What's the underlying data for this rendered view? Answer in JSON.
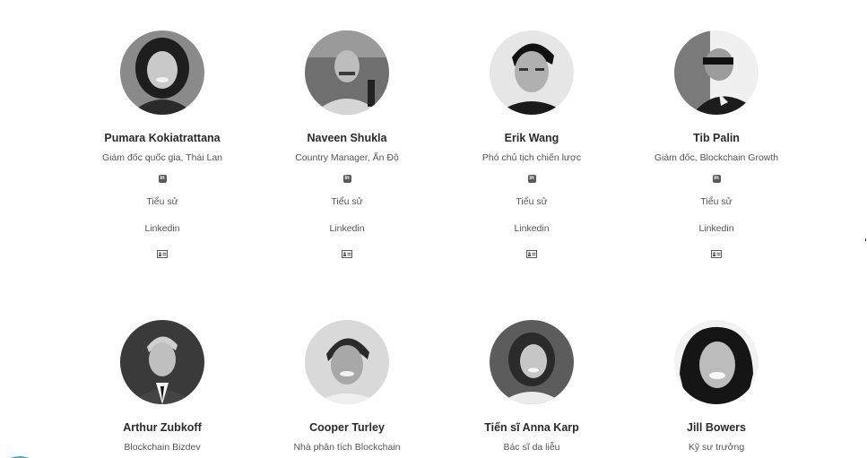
{
  "team": [
    {
      "name": "Pumara Kokiatrattana",
      "role": "Giám đốc quốc gia, Thái Lan",
      "bio": "Tiểu sử",
      "linkedin": "Linkedin",
      "li_glyph": "in",
      "icons": [
        "linkedin-icon",
        "contact-card-icon"
      ]
    },
    {
      "name": "Naveen Shukla",
      "role": "Country Manager, Ấn Độ",
      "bio": "Tiểu sử",
      "linkedin": "Linkedin",
      "li_glyph": "in",
      "icons": [
        "linkedin-icon",
        "contact-card-icon"
      ]
    },
    {
      "name": "Erik Wang",
      "role": "Phó chủ tịch chiến lược",
      "bio": "Tiểu sử",
      "linkedin": "Linkedin",
      "li_glyph": "in",
      "icons": [
        "linkedin-icon",
        "contact-card-icon"
      ]
    },
    {
      "name": "Tib Palin",
      "role": "Giám đốc, Blockchain Growth",
      "bio": "Tiểu sử",
      "linkedin": "Linkedin",
      "li_glyph": "in",
      "icons": [
        "linkedin-icon",
        "contact-card-icon"
      ]
    },
    {
      "name": "Arthur Zubkoff",
      "role": "Blockchain Bizdev"
    },
    {
      "name": "Cooper Turley",
      "role": "Nhà phân tích Blockchain"
    },
    {
      "name": "Tiến sĩ Anna Karp",
      "role": "Bác sĩ da liễu"
    },
    {
      "name": "Jill Bowers",
      "role": "Kỹ sư trưởng"
    }
  ],
  "colors": {
    "name_text": "#2b2b2b",
    "secondary_text": "#555555",
    "icon": "#5a5a5a",
    "accent_arc": "#4aa8c7"
  }
}
